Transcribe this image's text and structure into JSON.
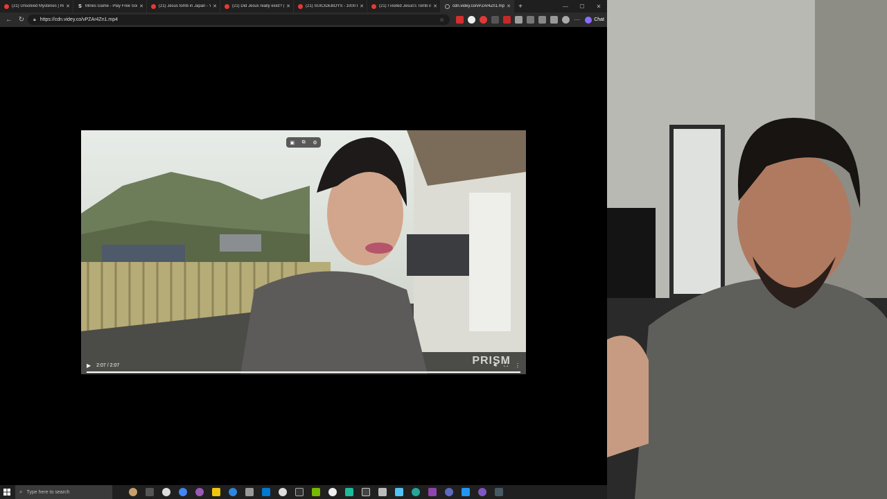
{
  "browser": {
    "tabs": [
      {
        "title": "(21) Unsolved Mysteries | Roll",
        "favicon": "youtube-icon"
      },
      {
        "title": "Mines Game - Play Free Socia",
        "favicon": "s-icon"
      },
      {
        "title": "(21) Jesus tomb in Japan - Yo",
        "favicon": "youtube-icon"
      },
      {
        "title": "(21) Did Jesus really exist? (w",
        "favicon": "youtube-icon"
      },
      {
        "title": "(21) SUICIDEBOYS - 1000 BL",
        "favicon": "youtube-icon"
      },
      {
        "title": "(21) I visited Jesus's Tomb in",
        "favicon": "youtube-icon"
      },
      {
        "title": "cdn.videy.co/vPZAr4Zn1.mp4",
        "favicon": "globe-icon"
      }
    ],
    "active_tab_index": 6,
    "url": "https://cdn.videy.co/vPZAr4Zn1.mp4",
    "chat_label": "Chat"
  },
  "video": {
    "time_display": "2:07 / 2:07",
    "progress": 1.0,
    "watermark": "PRISM"
  },
  "taskbar": {
    "search_placeholder": "Type here to search"
  },
  "colors": {
    "youtube_red": "#e53935",
    "tab_bg": "#1f1f1f",
    "address_bg": "#2b2b2b",
    "taskbar_bg": "#202020"
  }
}
